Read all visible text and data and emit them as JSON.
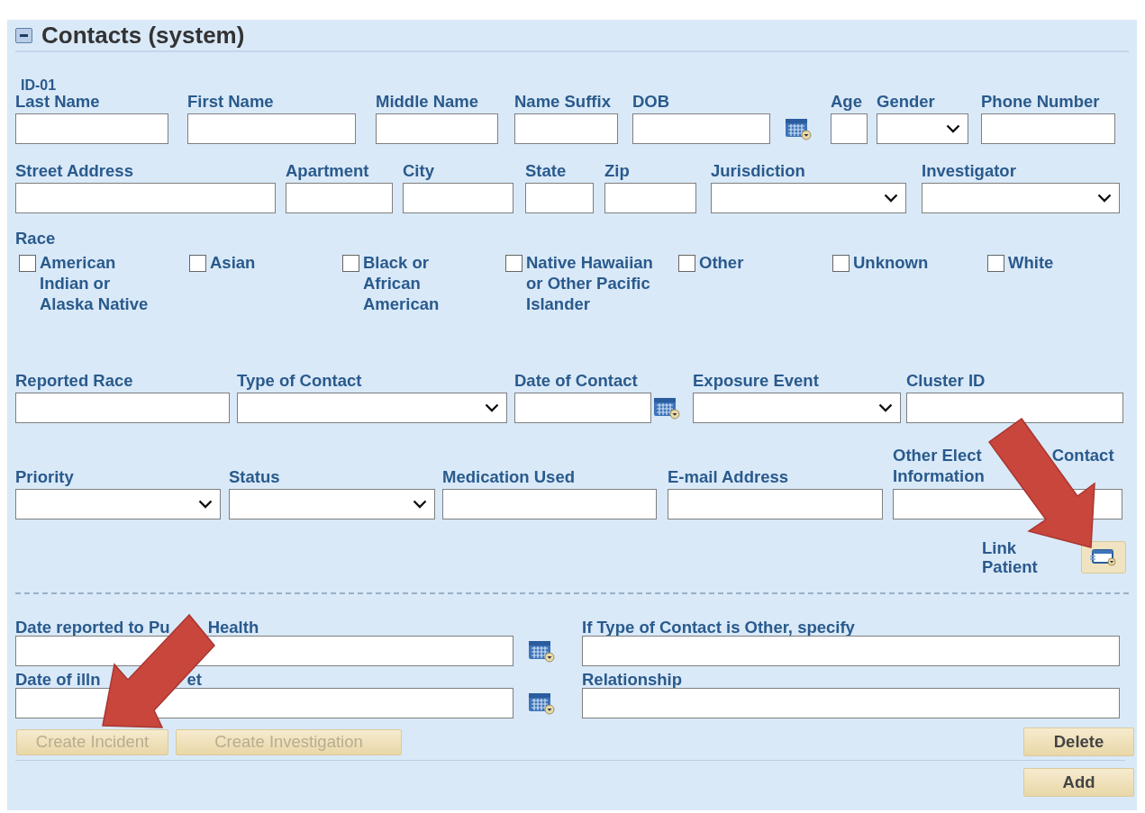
{
  "panel": {
    "title": "Contacts (system)",
    "expanded": true
  },
  "record_id": "ID-01",
  "rows": [
    [
      {
        "label": "Last Name",
        "kind": "text"
      },
      {
        "label": "First Name",
        "kind": "text"
      },
      {
        "label": "Middle Name",
        "kind": "text"
      },
      {
        "label": "Name Suffix",
        "kind": "text"
      },
      {
        "label": "DOB",
        "kind": "date"
      },
      {
        "label": "Age",
        "kind": "text"
      },
      {
        "label": "Gender",
        "kind": "select"
      },
      {
        "label": "Phone Number",
        "kind": "text"
      }
    ],
    [
      {
        "label": "Street Address",
        "kind": "text"
      },
      {
        "label": "Apartment",
        "kind": "text"
      },
      {
        "label": "City",
        "kind": "text"
      },
      {
        "label": "State",
        "kind": "text"
      },
      {
        "label": "Zip",
        "kind": "text"
      },
      {
        "label": "Jurisdiction",
        "kind": "select"
      },
      {
        "label": "Investigator",
        "kind": "select"
      }
    ],
    [
      {
        "label": "Reported Race",
        "kind": "text"
      },
      {
        "label": "Type of Contact",
        "kind": "select"
      },
      {
        "label": "Date of Contact",
        "kind": "date"
      },
      {
        "label": "Exposure Event",
        "kind": "select"
      },
      {
        "label": "Cluster ID",
        "kind": "text"
      }
    ],
    [
      {
        "label": "Priority",
        "kind": "select"
      },
      {
        "label": "Status",
        "kind": "select"
      },
      {
        "label": "Medication Used",
        "kind": "text"
      },
      {
        "label": "E-mail Address",
        "kind": "text"
      },
      {
        "label": [
          [
            "Other Elect",
            "Contact"
          ],
          [
            "Information"
          ]
        ],
        "kind": "text"
      }
    ]
  ],
  "race": {
    "label": "Race",
    "options": [
      {
        "label": "American Indian or Alaska Native",
        "checked": false
      },
      {
        "label": "Asian",
        "checked": false
      },
      {
        "label": "Black or African American",
        "checked": false
      },
      {
        "label": "Native Hawaiian or Other Pacific Islander",
        "checked": false
      },
      {
        "label": "Other",
        "checked": false
      },
      {
        "label": "Unknown",
        "checked": false
      },
      {
        "label": "White",
        "checked": false
      }
    ]
  },
  "link_patient": {
    "label": "Link Patient"
  },
  "lower_left": [
    {
      "label": [
        [
          "Date reported to Pu",
          "Health"
        ]
      ],
      "kind": "date"
    },
    {
      "label": [
        [
          "Date of illn",
          "et"
        ]
      ],
      "kind": "date"
    }
  ],
  "lower_right": [
    {
      "label": "If Type of Contact is Other, specify",
      "kind": "text"
    },
    {
      "label": "Relationship",
      "kind": "text"
    }
  ],
  "action_buttons": [
    {
      "label": "Create Incident",
      "disabled": true
    },
    {
      "label": "Create Investigation",
      "disabled": true
    }
  ],
  "delete_button": {
    "label": "Delete",
    "disabled": false
  },
  "add_button": {
    "label": "Add",
    "disabled": false
  }
}
